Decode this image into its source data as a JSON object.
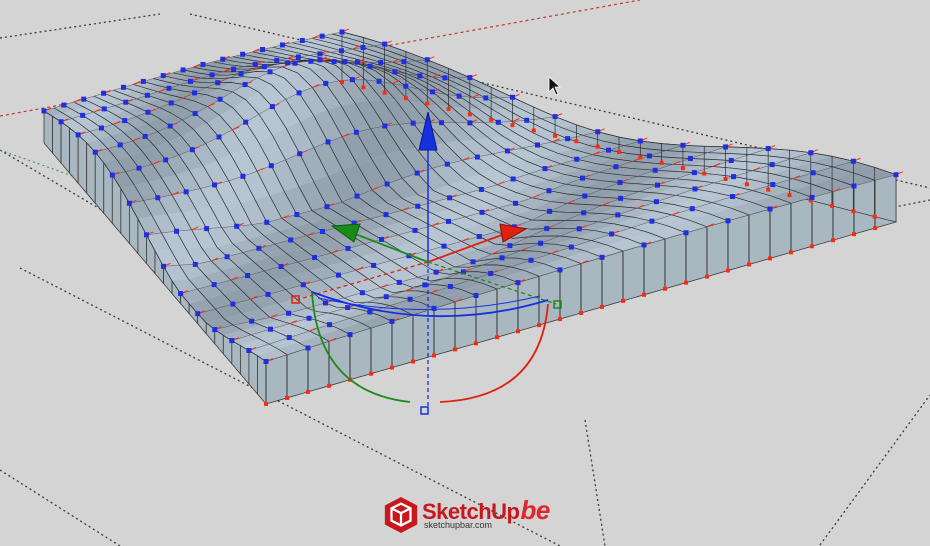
{
  "app": {
    "name": "SketchUp"
  },
  "viewport": {
    "background_color": "#d4d4d4",
    "surface_fill": "#a9b7c1",
    "surface_edge": "#2a2a2a",
    "control_point_color": "#1f2fe0",
    "pin_color": "#ff2b10",
    "axis_colors": {
      "x": "#e02010",
      "y": "#1a8a1a",
      "z": "#1530e0"
    }
  },
  "watermark": {
    "brand_prefix": "SketchUp",
    "brand_suffix": "be",
    "url": "sketchupbar.com"
  },
  "cursor": {
    "icon": "arrow-cursor-icon"
  }
}
